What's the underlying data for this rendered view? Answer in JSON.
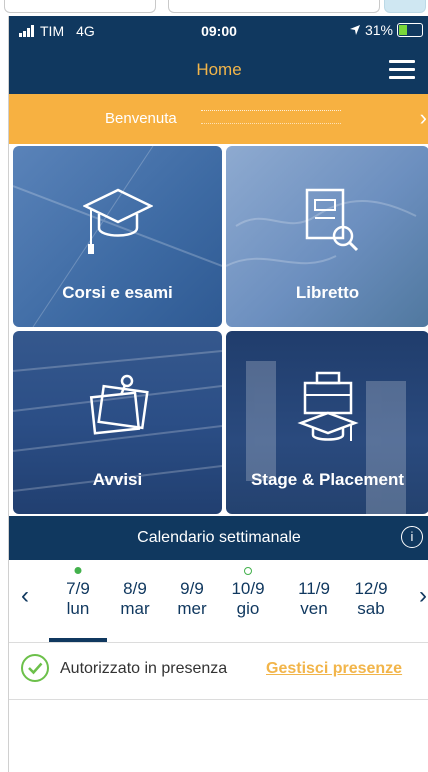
{
  "status_bar": {
    "carrier": "TIM",
    "network": "4G",
    "time": "09:00",
    "battery": "31%",
    "battery_level": 0.31
  },
  "header": {
    "title": "Home"
  },
  "welcome": {
    "text": "Benvenuta"
  },
  "tiles": [
    {
      "label": "Corsi e esami",
      "icon": "graduation-cap-icon"
    },
    {
      "label": "Libretto",
      "icon": "notebook-search-icon"
    },
    {
      "label": "Avvisi",
      "icon": "notice-board-icon"
    },
    {
      "label": "Stage & Placement",
      "icon": "briefcase-graduation-icon"
    }
  ],
  "calendar": {
    "title": "Calendario settimanale",
    "days": [
      {
        "date": "7/9",
        "weekday": "lun",
        "selected": true,
        "marker": "filled"
      },
      {
        "date": "8/9",
        "weekday": "mar",
        "selected": false,
        "marker": "none"
      },
      {
        "date": "9/9",
        "weekday": "mer",
        "selected": false,
        "marker": "none"
      },
      {
        "date": "10/9",
        "weekday": "gio",
        "selected": false,
        "marker": "hollow"
      },
      {
        "date": "11/9",
        "weekday": "ven",
        "selected": false,
        "marker": "none"
      },
      {
        "date": "12/9",
        "weekday": "sab",
        "selected": false,
        "marker": "none"
      }
    ]
  },
  "presence": {
    "status": "Autorizzato in presenza",
    "manage_link": "Gestisci presenze"
  },
  "colors": {
    "navy": "#10385f",
    "accent_orange": "#f7b141",
    "green": "#43b14c"
  }
}
